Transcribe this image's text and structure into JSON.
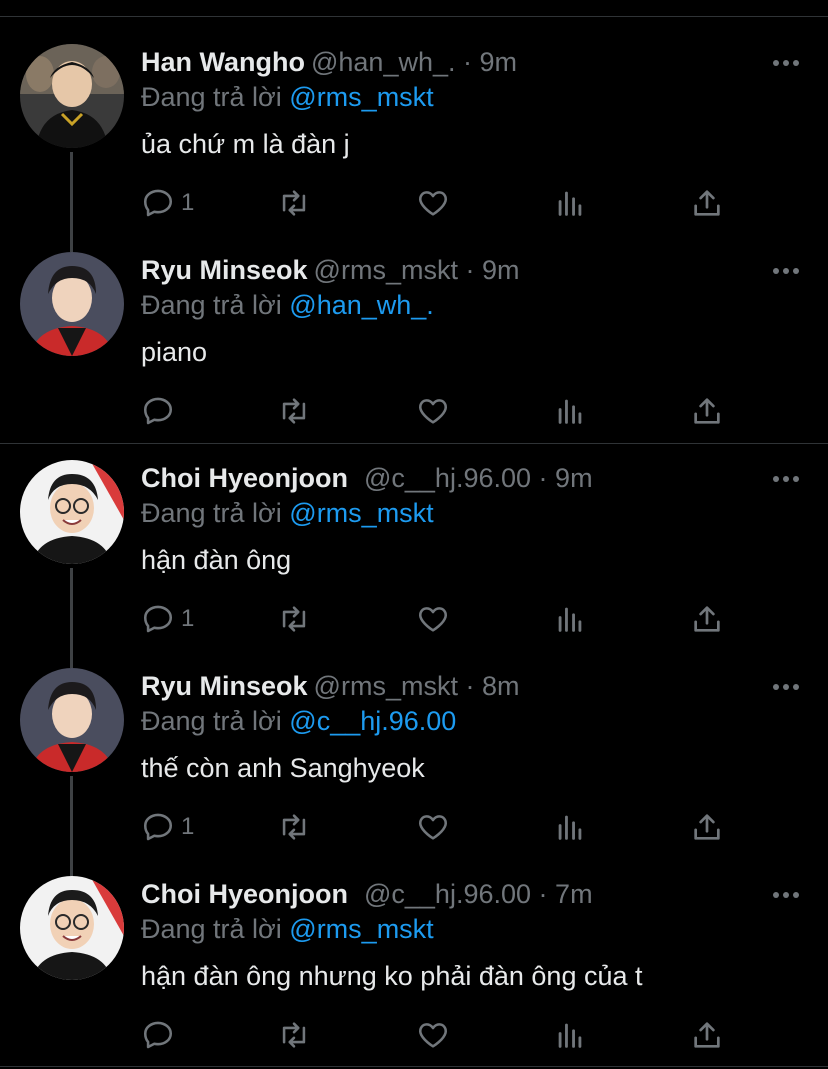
{
  "colors": {
    "background": "#000000",
    "text": "#e7e9ea",
    "muted": "#71767b",
    "accent": "#1d9bf0",
    "divider": "#2f3336"
  },
  "reply_prefix": "Đang trả lời",
  "tweets": [
    {
      "name": "Han Wangho",
      "handle": "@han_wh_.",
      "separator": "·",
      "time": "9m",
      "reply_to": "@rms_mskt",
      "text": "ủa chứ m là đàn j",
      "reply_count": "1",
      "avatar": "avatar-han-wangho"
    },
    {
      "name": "Ryu Minseok",
      "handle": "@rms_mskt",
      "separator": "·",
      "time": "9m",
      "reply_to": "@han_wh_.",
      "text": "piano",
      "reply_count": "",
      "avatar": "avatar-ryu-minseok"
    },
    {
      "name": "Choi Hyeonjoon",
      "handle": "@c__hj.96.00",
      "separator": "·",
      "time": "9m",
      "reply_to": "@rms_mskt",
      "text": "hận đàn ông",
      "reply_count": "1",
      "avatar": "avatar-choi-hyeonjoon"
    },
    {
      "name": "Ryu Minseok",
      "handle": "@rms_mskt",
      "separator": "·",
      "time": "8m",
      "reply_to": "@c__hj.96.00",
      "text": "thế còn anh Sanghyeok",
      "reply_count": "1",
      "avatar": "avatar-ryu-minseok"
    },
    {
      "name": "Choi Hyeonjoon",
      "handle": "@c__hj.96.00",
      "separator": "·",
      "time": "7m",
      "reply_to": "@rms_mskt",
      "text": "hận đàn ông nhưng ko phải đàn ông của t",
      "reply_count": "",
      "avatar": "avatar-choi-hyeonjoon"
    }
  ],
  "icons": {
    "reply": "reply-icon",
    "retweet": "retweet-icon",
    "like": "heart-icon",
    "analytics": "analytics-icon",
    "share": "share-icon",
    "more": "more-icon"
  }
}
